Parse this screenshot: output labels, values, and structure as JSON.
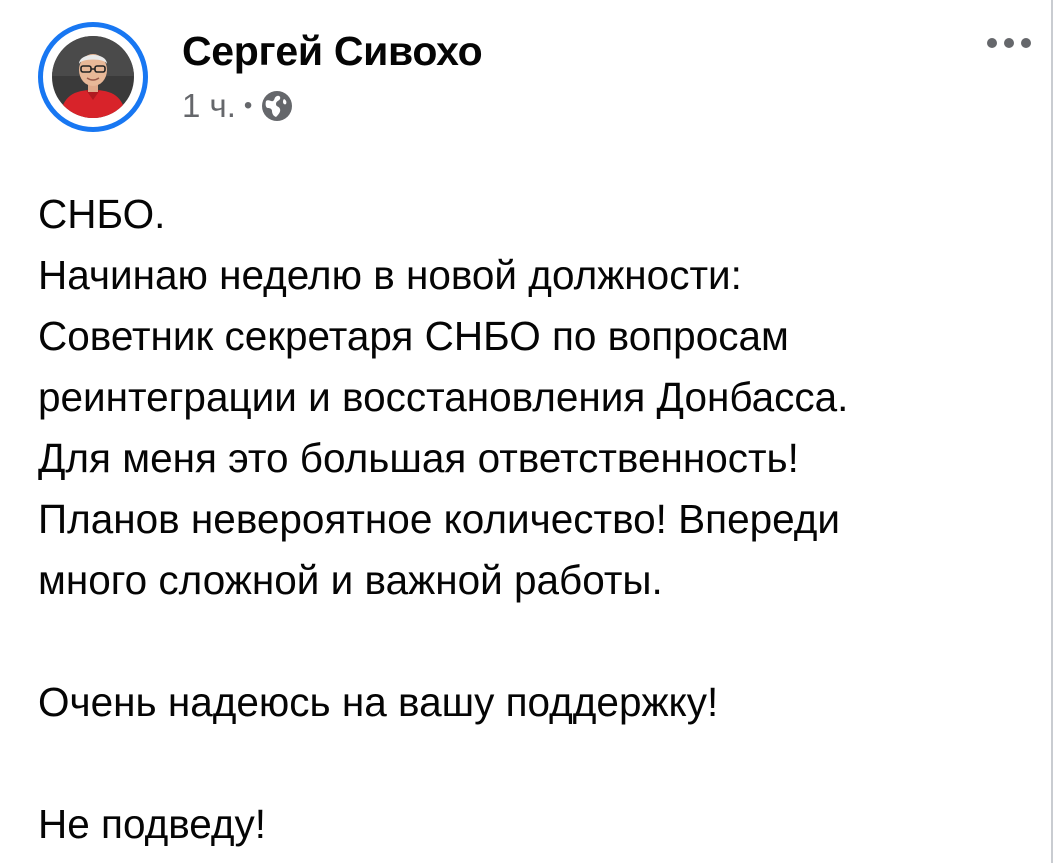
{
  "post": {
    "author": "Сергей Сивохо",
    "time": "1 ч.",
    "separator": "•",
    "privacy_icon": "globe-icon",
    "more_icon": "more-dots-icon",
    "accent_color": "#1877f2",
    "text_color": "#050505",
    "meta_color": "#65676b",
    "paragraphs": [
      {
        "lines": [
          "СНБО.",
          "Начинаю неделю в новой должности:",
          "Советник секретаря СНБО по вопросам",
          "реинтеграции и восстановления Донбасса.",
          "Для меня это большая ответственность!",
          "Планов невероятное количество! Впереди",
          "много сложной и важной работы."
        ]
      },
      {
        "lines": [
          "Очень надеюсь на вашу поддержку!"
        ]
      },
      {
        "lines": [
          "Не подведу!"
        ]
      }
    ]
  }
}
